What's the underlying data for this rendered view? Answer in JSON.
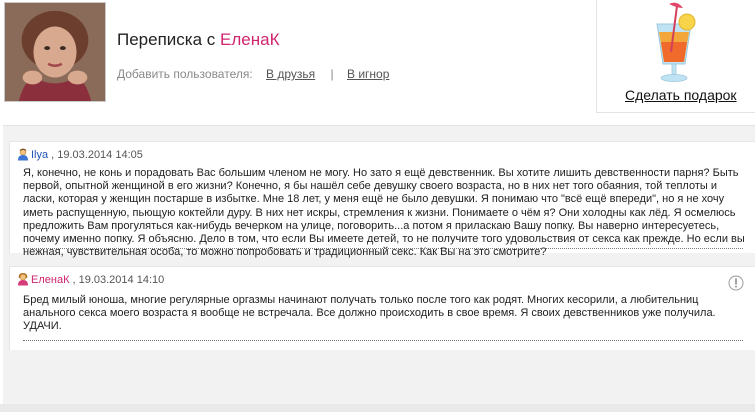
{
  "header": {
    "title_prefix": "Переписка с",
    "title_user": "ЕленаК",
    "add_user_label": "Добавить пользователя:",
    "to_friends": "В друзья",
    "separator": "|",
    "to_ignore": "В игнор"
  },
  "gift": {
    "link_label": "Сделать подарок",
    "icon": "cocktail-icon"
  },
  "messages": [
    {
      "author": "Ilya",
      "icon": "male-user-icon",
      "datetime": ", 19.03.2014 14:05",
      "text": "Я, конечно, не конь и порадовать Вас большим членом не могу. Но зато я ещё девственник. Вы хотите лишить девственности парня? Быть первой, опытной женщиной в его жизни? Конечно, я бы нашёл себе девушку своего возраста, но в них нет того обаяния, той теплоты и ласки, которая у женщин постарше в избытке. Мне 18 лет, у меня ещё не было девушки. Я понимаю что \"всё ещё впереди\", но я не хочу иметь распущенную, пьющую коктейли дуру. В них нет искры, стремления к жизни. Понимаете о чём я? Они холодны как лёд. Я осмелюсь предложить Вам прогуляться как-нибудь вечерком на улице, поговорить...а потом я приласкаю Вашу попку. Вы наверно интересуетесь, почему именно попку. Я объясню. Дело в том, что если Вы имеете детей, то не получите того удовольствия от секса как прежде. Но если вы нежная, чувствительная особа, то можно попробовать и традиционный секс. Как Вы на это смотрите?"
    },
    {
      "author": "ЕленаК",
      "icon": "female-user-icon",
      "datetime": ", 19.03.2014 14:10",
      "text": "Бред милый юноша, многие регулярные оргазмы начинают получать только после того как родят. Многих кесорили, а любительниц анального секса моего возраста я вообще не встречала. Все должно происходить в свое время. Я своих девственников уже получила. УДАЧИ."
    }
  ],
  "colors": {
    "female_name": "#d0246f",
    "male_name": "#2355b6",
    "panel_bg": "#f2f2f2"
  }
}
